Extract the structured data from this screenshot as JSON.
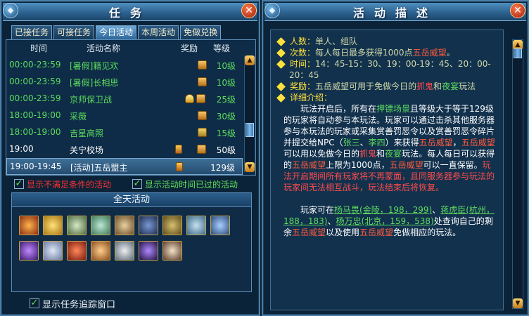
{
  "left": {
    "title": "任务",
    "tabs": [
      "已接任务",
      "可接任务",
      "今日活动",
      "本周活动",
      "免做兑换"
    ],
    "headers": {
      "time": "时间",
      "name": "活动名称",
      "reward": "奖励",
      "level": "等级"
    },
    "rows": [
      {
        "time": "00:00-23:59",
        "name": "[暑假]籍见欢",
        "level": "10级",
        "color": "#5ddc5d",
        "time_color": "#5ddc5d"
      },
      {
        "time": "00:00-23:59",
        "name": "[暑假]长相思",
        "level": "10级",
        "color": "#5ddc5d",
        "time_color": "#5ddc5d"
      },
      {
        "time": "00:00-23:59",
        "name": "京师保卫战",
        "level": "25级",
        "color": "#5ddc5d",
        "time_color": "#5ddc5d"
      },
      {
        "time": "18:00-19:00",
        "name": "采薇",
        "level": "30级",
        "color": "#5ddc5d",
        "time_color": "#5ddc5d"
      },
      {
        "time": "18:00-19:00",
        "name": "吉星高照",
        "level": "15级",
        "color": "#5ddc5d",
        "time_color": "#5ddc5d"
      },
      {
        "time": "19:00",
        "name": "关宁校场",
        "level": "50级",
        "color": "#ffffff",
        "time_color": "#ffffff"
      },
      {
        "time": "19:00-19:45",
        "name": "[活动]五岳盟主",
        "level": "129级",
        "color": "#ffffff",
        "time_color": "#ffffff"
      }
    ],
    "check_unmet": "显示不满足条件的活动",
    "check_expired": "显示活动时间已过的活动",
    "allday_title": "全天活动",
    "check_tracker": "显示任务追踪窗口",
    "accent_red": "#ff3030",
    "accent_green": "#5fe05a"
  },
  "right": {
    "title": "活动描述",
    "people_label": "人数：",
    "people_value": "单人、组队",
    "times_label": "次数：",
    "times_value_1": "每人每日最多获得1000点",
    "times_value_2": "五岳威望",
    "times_value_3": "。",
    "time_label": "时间：",
    "time_value_1": "14：45-15：30、19：00-19：45、20：00-",
    "time_value_2": "20：45",
    "reward_label": "奖励：",
    "reward_value_1": "五岳威望可用于免做今日的",
    "reward_value_2": "抓鬼",
    "reward_value_3": "和",
    "reward_value_4": "夜宴",
    "reward_value_5": "玩法",
    "detail_label": "详细介绍：",
    "p1_a": "玩法开启后，所有在",
    "p1_b": "押镖场景",
    "p1_c": "且等级大于等于129级的玩家将自动参与本玩法。玩家可以通过击杀其他服务器参与本玩法的玩家或采集赏善罚恶令以及赏善罚恶令碎片并提交给NPC（",
    "p1_d": "张三",
    "p1_e": "、",
    "p1_f": "李四",
    "p1_g": "）来获得",
    "p1_h": "五岳威望",
    "p1_i": "，",
    "p1_j": "五岳威望",
    "p1_k": "可以用以免做今日的",
    "p1_l": "抓鬼",
    "p1_m": "和",
    "p1_n": "夜宴",
    "p1_o": "玩法。每人每日可以获得的",
    "p1_p": "五岳威望",
    "p1_q": "上限为1000点，",
    "p1_r": "五岳威望",
    "p1_s": "可以一直保留。",
    "p1_t": "玩法开启期间所有玩家将不再蒙面，且同服务器参与玩法的玩家间无法相互战斗，玩法结束后将恢复。",
    "p2_a": "玩家可在",
    "p2_b": "杨马畏(金陵，198，299)",
    "p2_c": "、",
    "p2_d": "蒋虎臣(杭州，188，183)",
    "p2_e": "、",
    "p2_f": "杨万忠(北京，159，538)",
    "p2_g": "处查询自己的剩余",
    "p2_h": "五岳威望",
    "p2_i": "以及使用",
    "p2_j": "五岳威望",
    "p2_k": "免做相应的玩法。"
  },
  "icons": {
    "close": "close-icon",
    "scroll_up": "arrow-up-icon",
    "scroll_down": "arrow-down-icon",
    "check": "checkmark-icon"
  }
}
